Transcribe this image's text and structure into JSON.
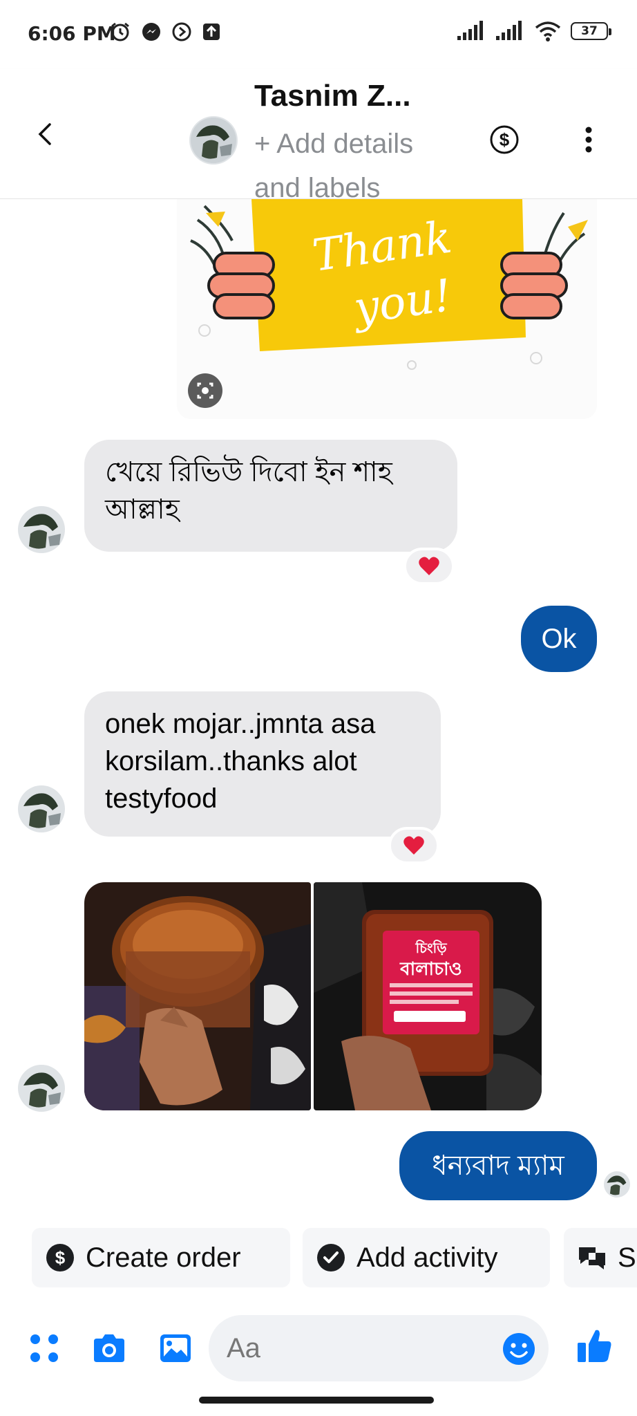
{
  "status_bar": {
    "time": "6:06 PM",
    "battery": "37"
  },
  "header": {
    "contact_name": "Tasnim Z...",
    "add_details": "+ Add details and labels"
  },
  "messages": [
    {
      "direction": "incoming",
      "text": "খেয়ে রিভিউ দিবো ইন শাহ আল্লাহ",
      "reaction": "heart"
    },
    {
      "direction": "outgoing",
      "text": "Ok"
    },
    {
      "direction": "incoming",
      "text": "onek mojar..jmnta asa korsilam..thanks alot testyfood",
      "reaction": "heart"
    },
    {
      "direction": "incoming",
      "type": "photos",
      "count": 2
    },
    {
      "direction": "outgoing",
      "text": "ধন্যবাদ ম্যাম"
    }
  ],
  "thank_card": {
    "line1": "Thank",
    "line2": "you!"
  },
  "product_label": {
    "title_top": "চিংড়ি",
    "title_main": "বালাচাও"
  },
  "actions": [
    {
      "label": "Create order",
      "icon": "dollar-circle-icon"
    },
    {
      "label": "Add activity",
      "icon": "check-circle-icon"
    },
    {
      "label": "S",
      "icon": "chat-bubbles-icon"
    }
  ],
  "composer": {
    "placeholder": "Aa"
  },
  "colors": {
    "outgoing_bubble": "#0a54a4",
    "incoming_bubble": "#e9e9eb",
    "accent": "#0a7cff",
    "reaction_heart": "#e41e3f"
  }
}
